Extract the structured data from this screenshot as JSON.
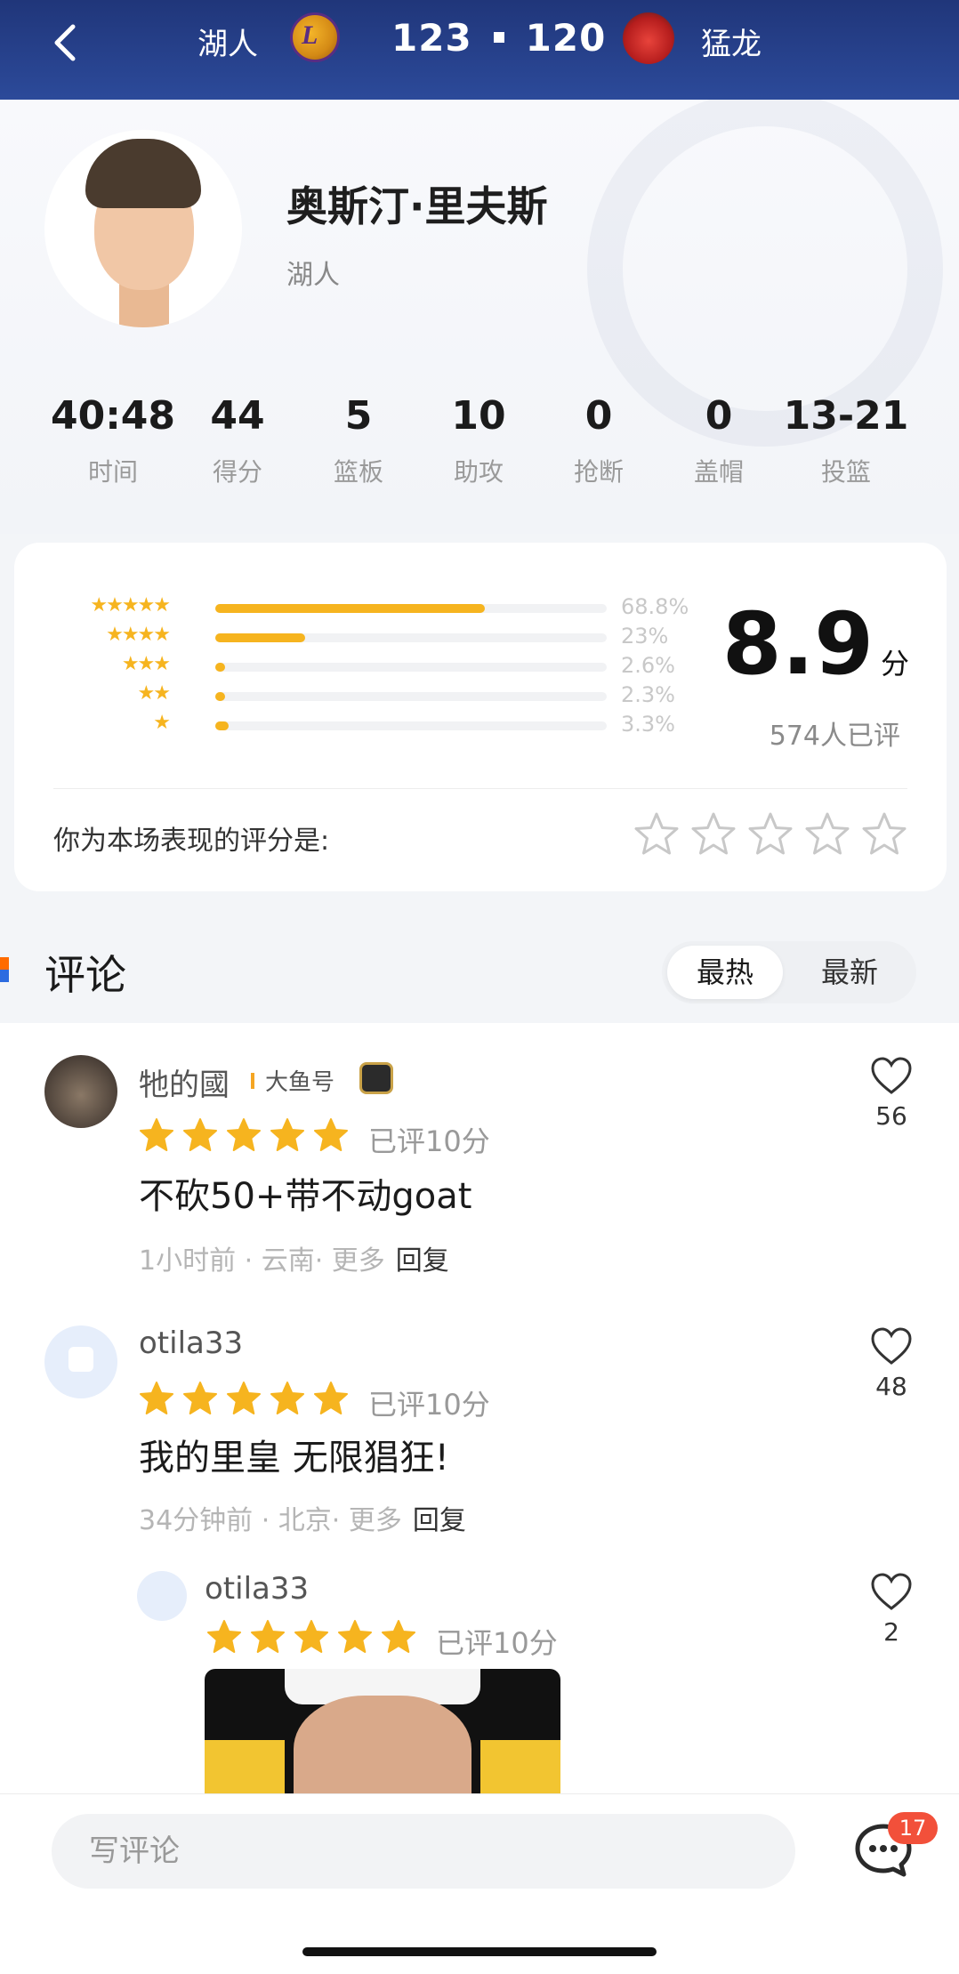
{
  "header": {
    "home_team": "湖人",
    "home_score": "123",
    "away_score": "120",
    "away_team": "猛龙"
  },
  "player": {
    "name": "奥斯汀·里夫斯",
    "team": "湖人"
  },
  "stats": [
    {
      "value": "40:48",
      "label": "时间"
    },
    {
      "value": "44",
      "label": "得分"
    },
    {
      "value": "5",
      "label": "篮板"
    },
    {
      "value": "10",
      "label": "助攻"
    },
    {
      "value": "0",
      "label": "抢断"
    },
    {
      "value": "0",
      "label": "盖帽"
    },
    {
      "value": "13-21",
      "label": "投篮"
    }
  ],
  "rating": {
    "distribution": [
      {
        "stars": 5,
        "pct_label": "68.8%",
        "fraction": 0.688
      },
      {
        "stars": 4,
        "pct_label": "23%",
        "fraction": 0.23
      },
      {
        "stars": 3,
        "pct_label": "2.6%",
        "fraction": 0.026
      },
      {
        "stars": 2,
        "pct_label": "2.3%",
        "fraction": 0.023
      },
      {
        "stars": 1,
        "pct_label": "3.3%",
        "fraction": 0.033
      }
    ],
    "score": "8.9",
    "score_unit": "分",
    "raters": "574人已评",
    "prompt": "你为本场表现的评分是:"
  },
  "comments_section": {
    "title": "评论",
    "sort_hot": "最热",
    "sort_new": "最新"
  },
  "comments": [
    {
      "user": "牠的國",
      "badge": "大鱼号",
      "rated": "已评10分",
      "stars": 5,
      "text": "不砍50+带不动goat",
      "time_loc": "1小时前 · 云南· 更多",
      "reply": "回复",
      "likes": "56"
    },
    {
      "user": "otila33",
      "rated": "已评10分",
      "stars": 5,
      "text": "我的里皇 无限猖狂!",
      "time_loc": "34分钟前 · 北京· 更多",
      "reply": "回复",
      "likes": "48"
    },
    {
      "user": "otila33",
      "rated": "已评10分",
      "stars": 5,
      "likes": "2"
    }
  ],
  "bottom": {
    "placeholder": "写评论",
    "notif_count": "17"
  },
  "colors": {
    "header_bg": "#20367a",
    "star_gold": "#f6b41f",
    "badge_red": "#f2503a"
  }
}
